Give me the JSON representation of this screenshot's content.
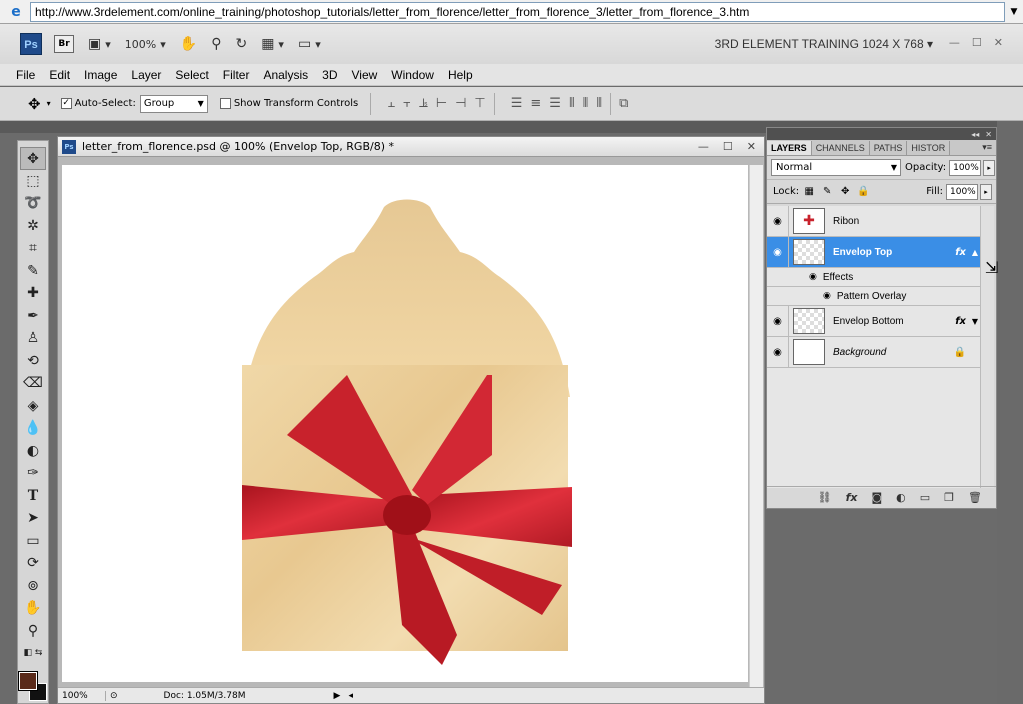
{
  "browser": {
    "url": "http://www.3rdelement.com/online_training/photoshop_tutorials/letter_from_florence/letter_from_florence_3/letter_from_florence_3.htm"
  },
  "appbar": {
    "ps_logo": "Ps",
    "br_logo": "Br",
    "zoom": "100%",
    "workspace": "3RD ELEMENT TRAINING 1024 X 768"
  },
  "menu": [
    "File",
    "Edit",
    "Image",
    "Layer",
    "Select",
    "Filter",
    "Analysis",
    "3D",
    "View",
    "Window",
    "Help"
  ],
  "options": {
    "auto_select_label": "Auto-Select:",
    "auto_select_value": "Group",
    "show_transform_label": "Show Transform Controls"
  },
  "document": {
    "title": "letter_from_florence.psd @ 100% (Envelop Top, RGB/8) *",
    "zoom": "100%",
    "doc_info": "Doc: 1.05M/3.78M"
  },
  "colors": {
    "foreground": "#5a2a1a",
    "background": "#111111",
    "selected_layer": "#3a8ee6"
  },
  "layers_panel": {
    "tabs": [
      "LAYERS",
      "CHANNELS",
      "PATHS",
      "HISTOR"
    ],
    "blend_mode": "Normal",
    "opacity_label": "Opacity:",
    "opacity": "100%",
    "lock_label": "Lock:",
    "fill_label": "Fill:",
    "fill": "100%",
    "layers": [
      {
        "name": "Ribon"
      },
      {
        "name": "Envelop Top",
        "fx": "fx"
      },
      {
        "name": "Effects"
      },
      {
        "name": "Pattern Overlay"
      },
      {
        "name": "Envelop Bottom",
        "fx": "fx"
      },
      {
        "name": "Background"
      }
    ]
  }
}
